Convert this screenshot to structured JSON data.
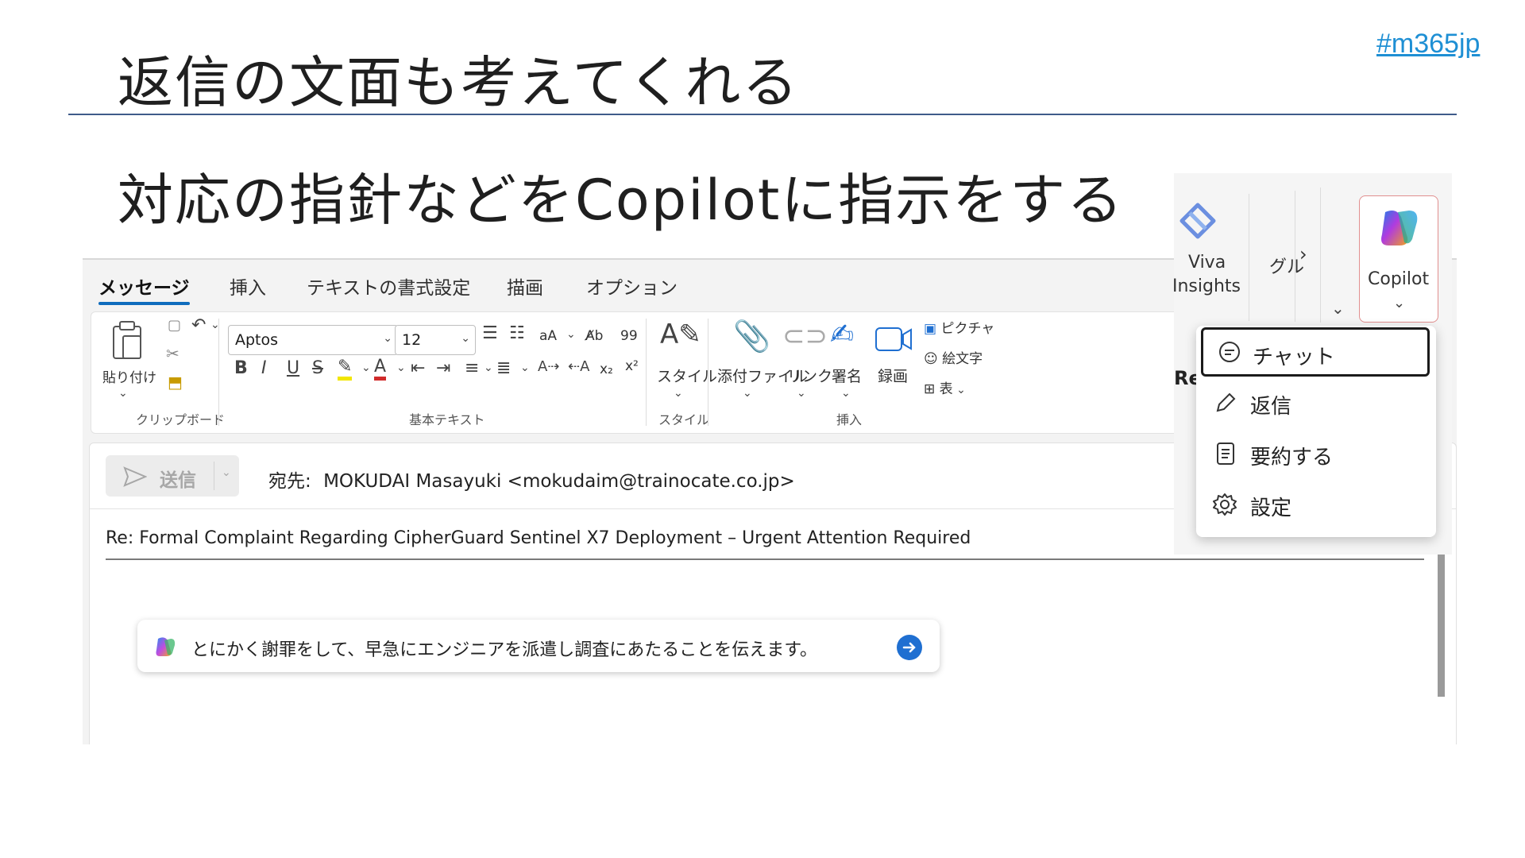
{
  "slide": {
    "title": "返信の文面も考えてくれる",
    "subtitle": "対応の指針などをCopilotに指示をする",
    "hashtag": "#m365jp"
  },
  "tabs": [
    "メッセージ",
    "挿入",
    "テキストの書式設定",
    "描画",
    "オプション"
  ],
  "ribbon": {
    "clipboard": {
      "paste": "貼り付け",
      "group": "クリップボード"
    },
    "basic_text": {
      "font": "Aptos",
      "size": "12",
      "group": "基本テキスト",
      "aa": "aA",
      "quote": "99",
      "sub": "x₂",
      "sup": "x²"
    },
    "style": {
      "label": "スタイル",
      "group": "スタイル"
    },
    "insert": {
      "attach": "添付ファイル",
      "link": "リンク",
      "signature": "署名",
      "record": "録画",
      "picture": "ピクチャ",
      "emoji": "絵文字",
      "table": "表",
      "group": "挿入"
    },
    "viva": {
      "line1": "Viva",
      "line2": "Insights"
    },
    "group_cut": "グル",
    "copilot": "Copilot"
  },
  "compose": {
    "send": "送信",
    "to_label": "宛先:",
    "to_value": "MOKUDAI Masayuki <mokudaim@trainocate.co.jp>",
    "subject": "Re: Formal Complaint Regarding CipherGuard Sentinel X7 Deployment – Urgent Attention Required",
    "prompt_text": "とにかく謝罪をして、早急にエンジニアを派遣し調査にあたることを伝えます。",
    "partial_right": "Re"
  },
  "copilot_menu": [
    {
      "icon": "chat-icon",
      "label": "チャット"
    },
    {
      "icon": "pen-icon",
      "label": "返信"
    },
    {
      "icon": "document-icon",
      "label": "要約する"
    },
    {
      "icon": "gear-icon",
      "label": "設定"
    }
  ],
  "colors": {
    "accent": "#0f6cbd",
    "title_rule": "#3f5b8a",
    "hashtag": "#1e8fd4"
  }
}
